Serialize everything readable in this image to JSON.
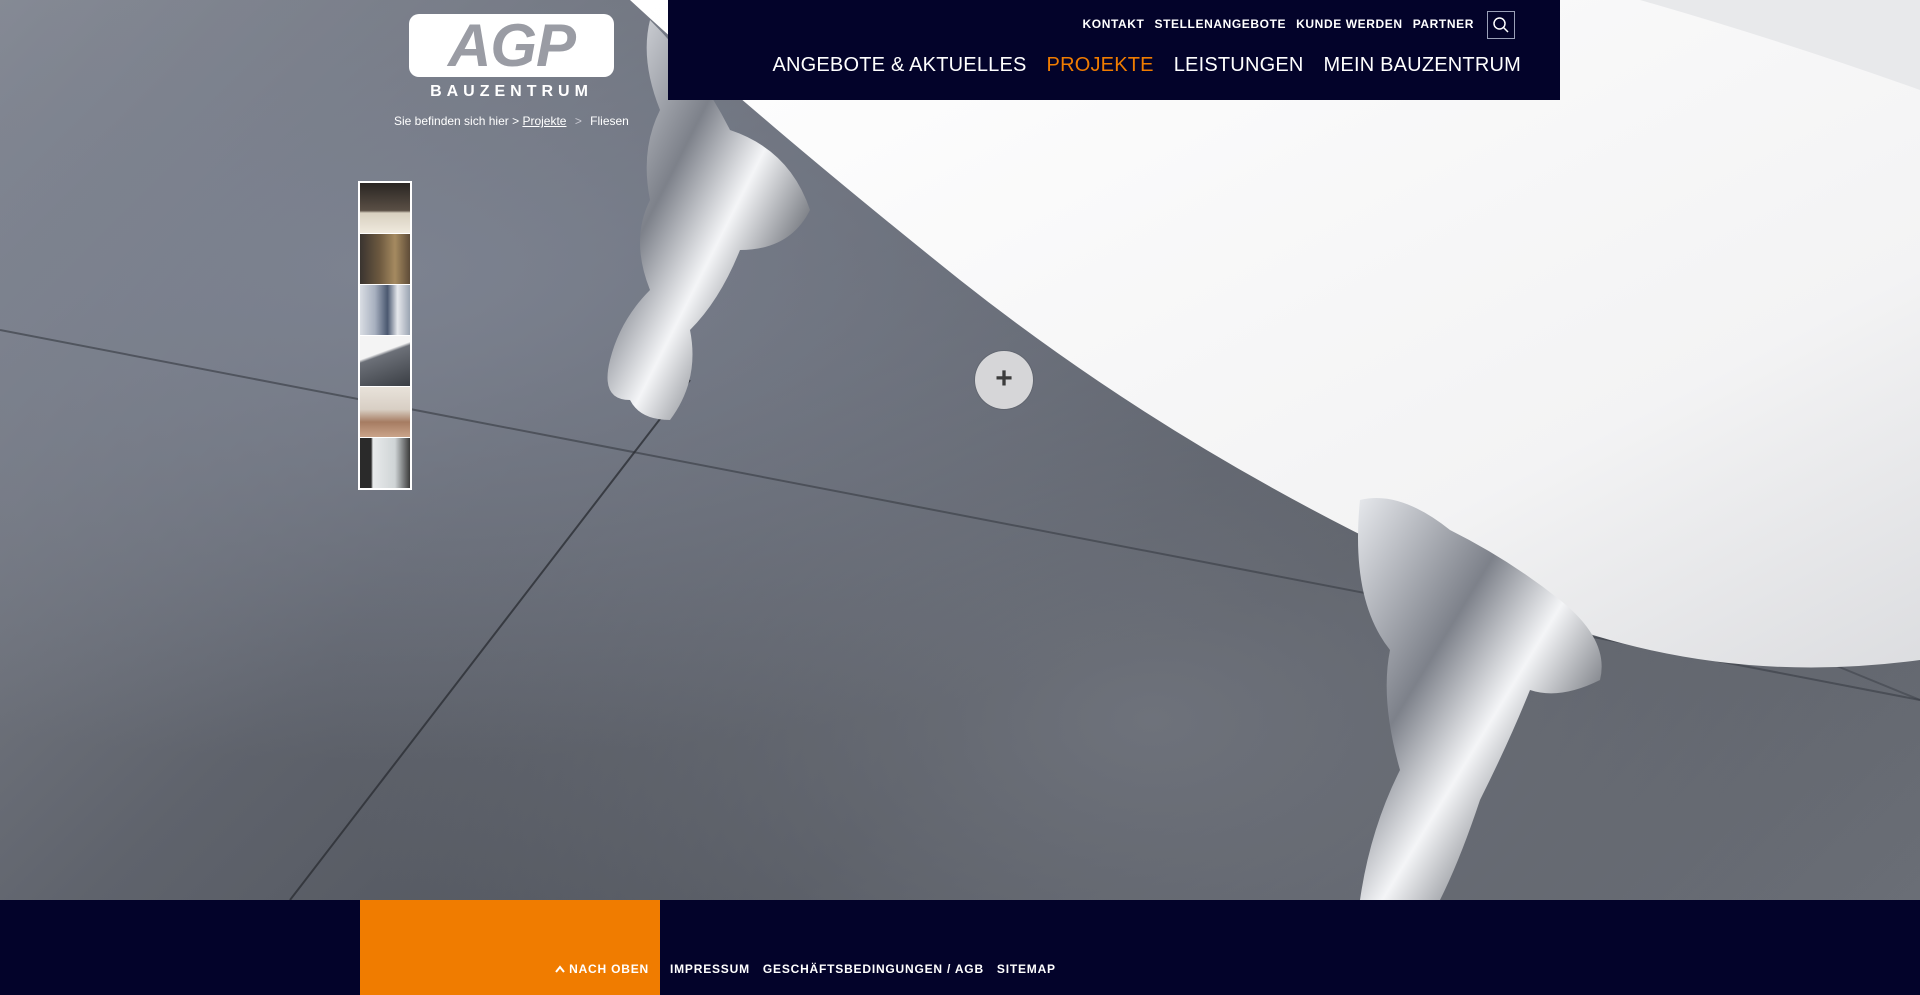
{
  "logo": {
    "letters": "AGP",
    "subtitle": "BAUZENTRUM"
  },
  "header": {
    "util_nav": [
      "KONTAKT",
      "STELLENANGEBOTE",
      "KUNDE WERDEN",
      "PARTNER"
    ],
    "main_nav": [
      "ANGEBOTE & AKTUELLES",
      "PROJEKTE",
      "LEISTUNGEN",
      "MEIN BAUZENTRUM"
    ],
    "active_nav": "PROJEKTE",
    "search_icon": "search-icon"
  },
  "breadcrumb": {
    "prefix": "Sie befinden sich hier >",
    "link": "Projekte",
    "separator": ">",
    "current": "Fliesen"
  },
  "gallery": {
    "zoom_label": "+",
    "thumbnails": 6
  },
  "footer": {
    "back_to_top": "NACH OBEN",
    "links": [
      "IMPRESSUM",
      "GESCHÄFTSBEDINGUNGEN / AGB",
      "SITEMAP"
    ]
  },
  "colors": {
    "navy": "#03032a",
    "accent": "#f07c00",
    "white": "#ffffff"
  }
}
